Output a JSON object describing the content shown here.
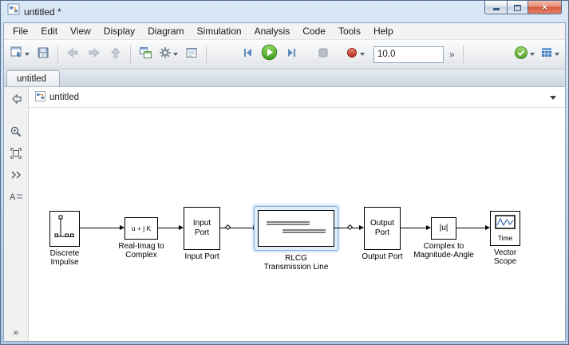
{
  "window": {
    "title": "untitled *",
    "close_glyph": "×"
  },
  "menu": {
    "items": [
      "File",
      "Edit",
      "View",
      "Display",
      "Diagram",
      "Simulation",
      "Analysis",
      "Code",
      "Tools",
      "Help"
    ]
  },
  "toolbar": {
    "sim_stop_time": "10.0",
    "overflow_chevron": "»"
  },
  "tabs": {
    "active": "untitled"
  },
  "breadcrumb": {
    "title": "untitled"
  },
  "sidebar": {
    "overflow_chevron": "»"
  },
  "canvas": {
    "blocks": {
      "discrete_impulse": {
        "label1": "Discrete",
        "label2": "Impulse"
      },
      "real_imag": {
        "icon_text": "u + j K",
        "label1": "Real-Imag to",
        "label2": "Complex"
      },
      "input_port": {
        "icon_line1": "Input",
        "icon_line2": "Port",
        "label": "Input Port"
      },
      "rlcg": {
        "label1": "RLCG",
        "label2": "Transmission Line"
      },
      "output_port": {
        "icon_line1": "Output",
        "icon_line2": "Port",
        "label": "Output Port"
      },
      "complex_to_mag": {
        "icon_text": "|u|",
        "label1": "Complex to",
        "label2": "Magnitude-Angle"
      },
      "vector_scope": {
        "icon_text": "Time",
        "label1": "Vector",
        "label2": "Scope"
      }
    }
  }
}
